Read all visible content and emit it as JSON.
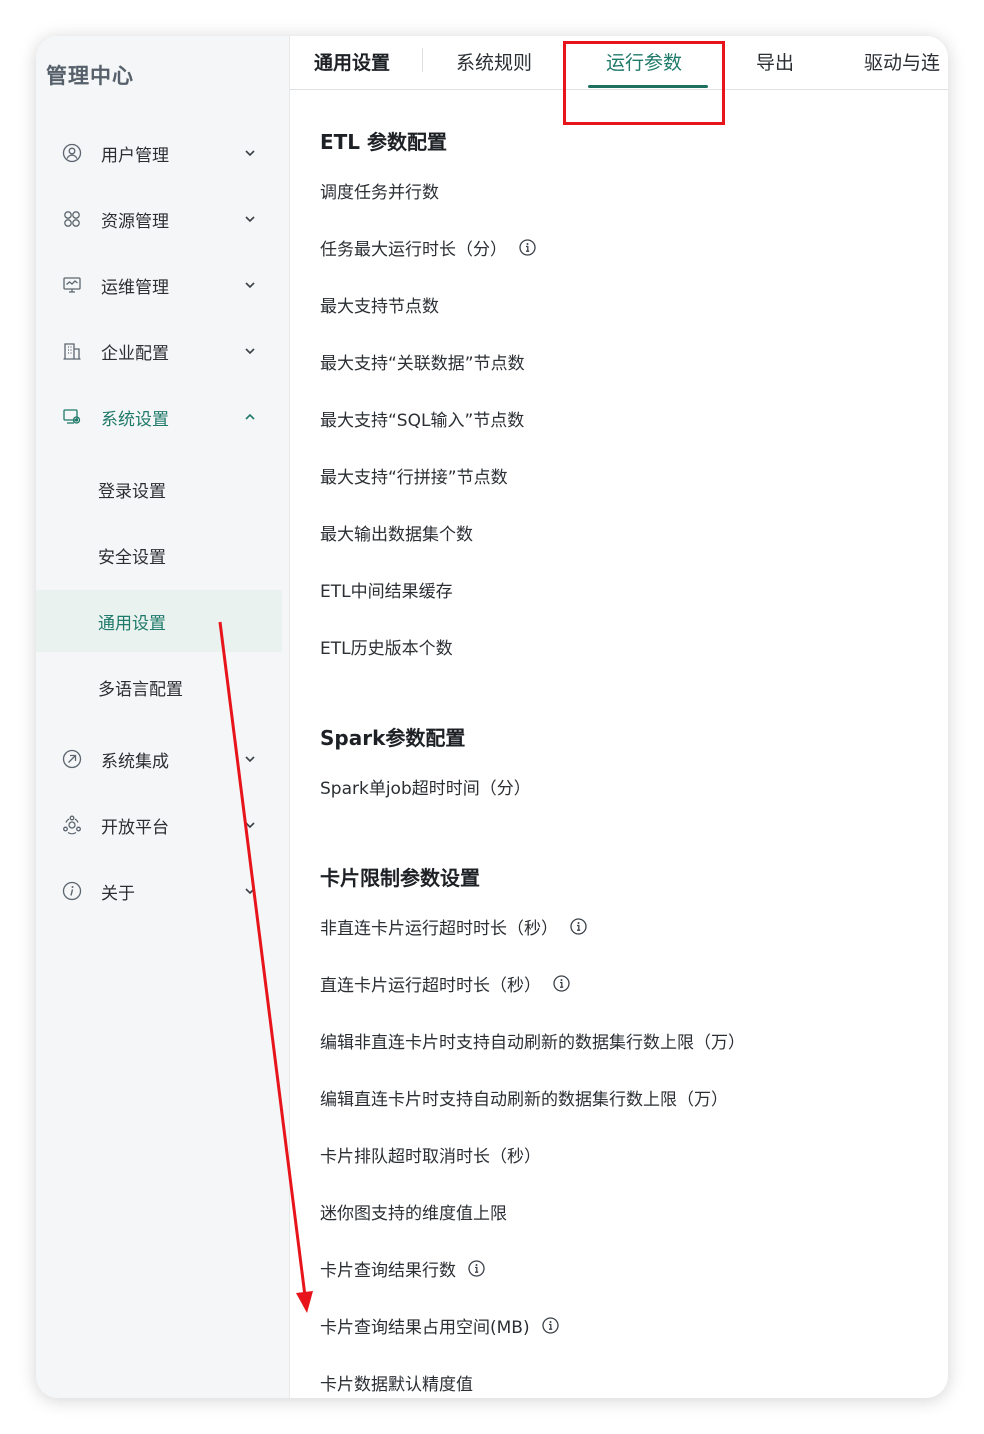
{
  "app_title": "管理中心",
  "sidebar": {
    "items": [
      {
        "label": "用户管理",
        "icon": "user-icon",
        "expanded": false
      },
      {
        "label": "资源管理",
        "icon": "grid-icon",
        "expanded": false
      },
      {
        "label": "运维管理",
        "icon": "monitor-icon",
        "expanded": false
      },
      {
        "label": "企业配置",
        "icon": "building-icon",
        "expanded": false
      },
      {
        "label": "系统设置",
        "icon": "settings-icon",
        "expanded": true
      },
      {
        "label": "系统集成",
        "icon": "integration-icon",
        "expanded": false
      },
      {
        "label": "开放平台",
        "icon": "platform-icon",
        "expanded": false
      },
      {
        "label": "关于",
        "icon": "info-icon",
        "expanded": false
      }
    ],
    "sub_items": [
      {
        "label": "登录设置"
      },
      {
        "label": "安全设置"
      },
      {
        "label": "通用设置",
        "selected": true
      },
      {
        "label": "多语言配置"
      }
    ]
  },
  "tabs": {
    "first": "通用设置",
    "items": [
      "系统规则",
      "运行参数",
      "导出",
      "驱动与连"
    ],
    "active": "运行参数"
  },
  "sections": [
    {
      "title": "ETL 参数配置",
      "params": [
        {
          "label": "调度任务并行数",
          "info": false
        },
        {
          "label": "任务最大运行时长（分）",
          "info": true
        },
        {
          "label": "最大支持节点数",
          "info": false
        },
        {
          "label": "最大支持“关联数据”节点数",
          "info": false
        },
        {
          "label": "最大支持“SQL输入”节点数",
          "info": false
        },
        {
          "label": "最大支持“行拼接”节点数",
          "info": false
        },
        {
          "label": "最大输出数据集个数",
          "info": false
        },
        {
          "label": "ETL中间结果缓存",
          "info": false
        },
        {
          "label": "ETL历史版本个数",
          "info": false
        }
      ]
    },
    {
      "title": "Spark参数配置",
      "params": [
        {
          "label": "Spark单job超时时间（分）",
          "info": false
        }
      ]
    },
    {
      "title": "卡片限制参数设置",
      "params": [
        {
          "label": "非直连卡片运行超时时长（秒）",
          "info": true
        },
        {
          "label": "直连卡片运行超时时长（秒）",
          "info": true
        },
        {
          "label": "编辑非直连卡片时支持自动刷新的数据集行数上限（万）",
          "info": false
        },
        {
          "label": "编辑直连卡片时支持自动刷新的数据集行数上限（万）",
          "info": false
        },
        {
          "label": "卡片排队超时取消时长（秒）",
          "info": false
        },
        {
          "label": "迷你图支持的维度值上限",
          "info": false
        },
        {
          "label": "卡片查询结果行数",
          "info": true
        },
        {
          "label": "卡片查询结果占用空间(MB)",
          "info": true
        },
        {
          "label": "卡片数据默认精度值",
          "info": false
        }
      ]
    }
  ],
  "colors": {
    "accent": "#1f7a6a",
    "annotation": "#e8141b",
    "sidebar_bg": "#f5f6f7",
    "selected_bg": "#e9f2ef"
  }
}
